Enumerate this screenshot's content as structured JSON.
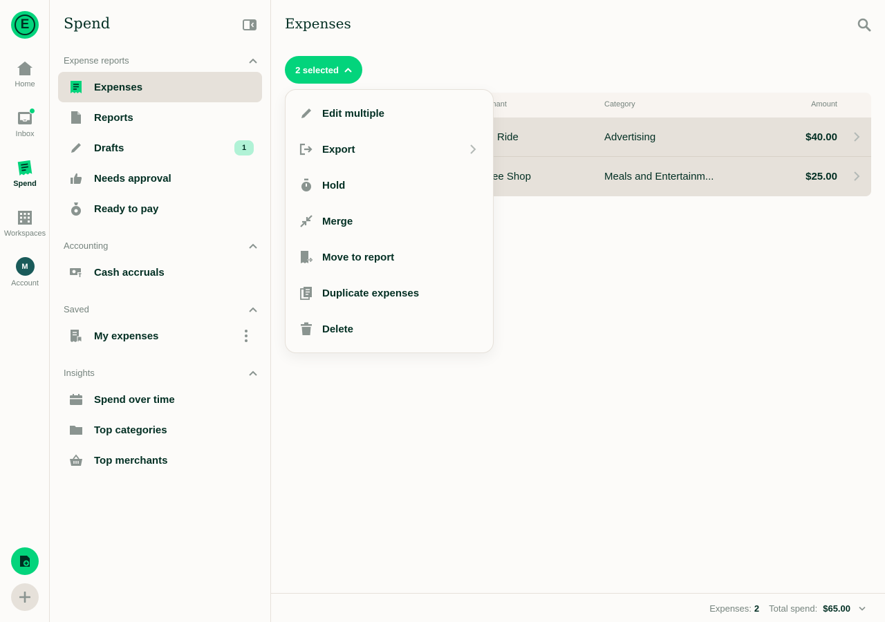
{
  "rail": {
    "logo_letter": "E",
    "items": [
      {
        "label": "Home",
        "icon": "home-icon"
      },
      {
        "label": "Inbox",
        "icon": "inbox-icon"
      },
      {
        "label": "Spend",
        "icon": "receipt-icon"
      },
      {
        "label": "Workspaces",
        "icon": "building-icon"
      },
      {
        "label": "Account",
        "icon": "avatar"
      }
    ],
    "account_initial": "M"
  },
  "sidebar": {
    "title": "Spend",
    "sections": [
      {
        "title": "Expense reports",
        "items": [
          {
            "label": "Expenses",
            "icon": "receipt-icon"
          },
          {
            "label": "Reports",
            "icon": "document-icon"
          },
          {
            "label": "Drafts",
            "icon": "pencil-icon",
            "badge": "1"
          },
          {
            "label": "Needs approval",
            "icon": "thumbs-up-icon"
          },
          {
            "label": "Ready to pay",
            "icon": "money-bag-icon"
          }
        ]
      },
      {
        "title": "Accounting",
        "items": [
          {
            "label": "Cash accruals",
            "icon": "cash-icon"
          }
        ]
      },
      {
        "title": "Saved",
        "items": [
          {
            "label": "My expenses",
            "icon": "bookmark-receipt-icon"
          }
        ]
      },
      {
        "title": "Insights",
        "items": [
          {
            "label": "Spend over time",
            "icon": "calendar-icon"
          },
          {
            "label": "Top categories",
            "icon": "folder-icon"
          },
          {
            "label": "Top merchants",
            "icon": "basket-icon"
          }
        ]
      }
    ]
  },
  "main": {
    "title": "Expenses",
    "selected_label": "2 selected",
    "table": {
      "headers": [
        "chant",
        "Category",
        "Amount"
      ],
      "rows": [
        {
          "merchant": "xi Ride",
          "category": "Advertising",
          "amount": "$40.00"
        },
        {
          "merchant": "ffee Shop",
          "category": "Meals and Entertainm...",
          "amount": "$25.00"
        }
      ]
    },
    "footer": {
      "expenses_label": "Expenses:",
      "expenses_count": "2",
      "total_label": "Total spend:",
      "total_value": "$65.00"
    }
  },
  "menu": {
    "items": [
      {
        "label": "Edit multiple",
        "icon": "pencil-icon"
      },
      {
        "label": "Export",
        "icon": "export-icon"
      },
      {
        "label": "Hold",
        "icon": "stopwatch-icon"
      },
      {
        "label": "Merge",
        "icon": "merge-icon"
      },
      {
        "label": "Move to report",
        "icon": "move-receipt-icon"
      },
      {
        "label": "Duplicate expenses",
        "icon": "duplicate-icon"
      },
      {
        "label": "Delete",
        "icon": "trash-icon"
      }
    ]
  },
  "colors": {
    "brand_green": "#03d47c",
    "text_dark": "#002e22",
    "muted": "#76847e",
    "icon_grey": "#8a9490",
    "active_bg": "#e6e1da"
  }
}
